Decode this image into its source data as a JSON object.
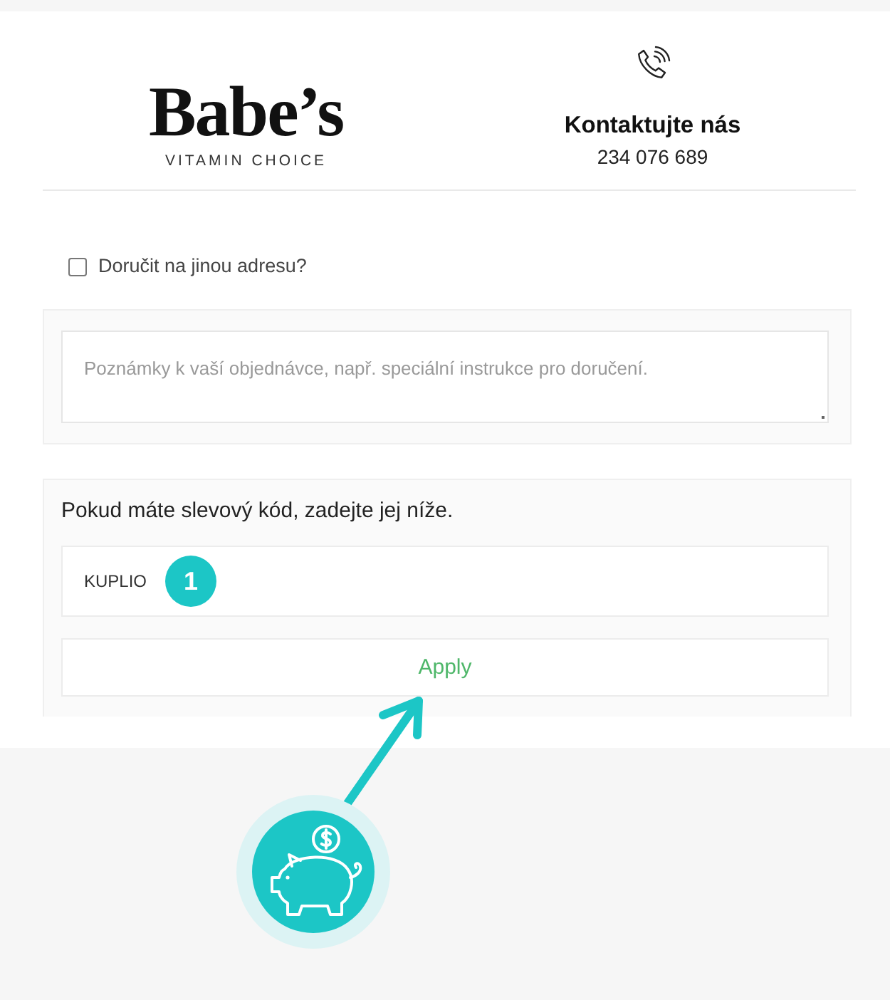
{
  "header": {
    "logo": {
      "wordmark": "Babe’s",
      "tagline": "VITAMIN CHOICE"
    },
    "contact": {
      "title": "Kontaktujte nás",
      "phone": "234 076 689"
    }
  },
  "shipping_option": {
    "label": "Doručit na jinou adresu?",
    "checked": false
  },
  "order_notes": {
    "placeholder": "Poznámky k vaší objednávce, např. speciální instrukce pro doručení."
  },
  "coupon": {
    "prompt": "Pokud máte slevový kód, zadejte jej níže.",
    "value": "KUPLIO",
    "apply_button": "Apply"
  },
  "annotations": {
    "step_badge": "1"
  }
}
